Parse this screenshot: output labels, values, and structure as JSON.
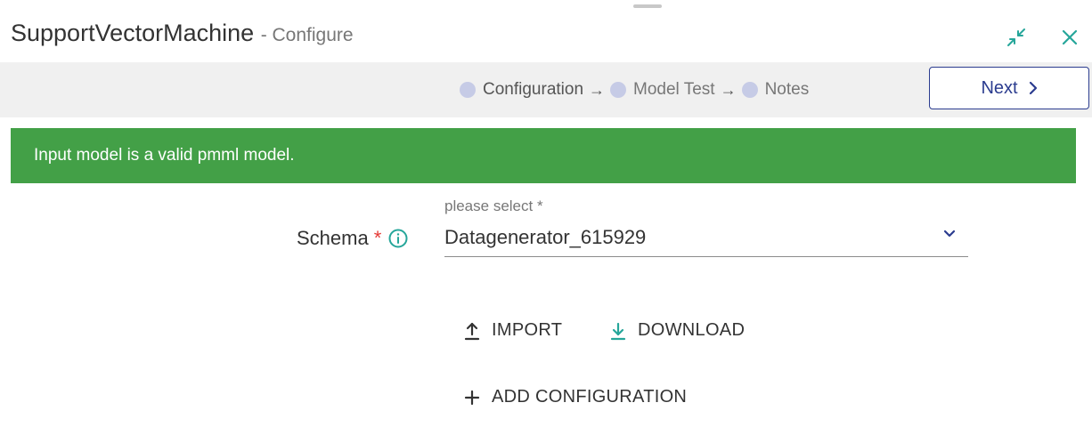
{
  "dialog": {
    "title": "SupportVectorMachine",
    "subtitle": "- Configure"
  },
  "stepper": {
    "steps": [
      {
        "label": "Configuration",
        "active": true
      },
      {
        "label": "Model Test",
        "active": false
      },
      {
        "label": "Notes",
        "active": false
      }
    ],
    "arrow": "→",
    "next_label": "Next"
  },
  "alert": {
    "message": "Input model is a valid pmml model.",
    "color": "#43a047"
  },
  "schema": {
    "label": "Schema",
    "required_mark": "*",
    "select_label": "please select *",
    "selected_value": "Datagenerator_615929"
  },
  "actions": {
    "import_label": "IMPORT",
    "download_label": "DOWNLOAD",
    "add_configuration_label": "ADD CONFIGURATION"
  },
  "colors": {
    "accent_teal": "#26a69a",
    "primary_navy": "#2b3c8f",
    "step_dot": "#c6cbe6",
    "required_red": "#e53935"
  },
  "icons": {
    "minimize": "minimize-icon",
    "close": "close-icon",
    "next_chevron": "chevron-right-icon",
    "info": "info-icon",
    "dropdown": "chevron-down-icon",
    "import": "upload-icon",
    "download": "download-icon",
    "add": "plus-icon"
  }
}
